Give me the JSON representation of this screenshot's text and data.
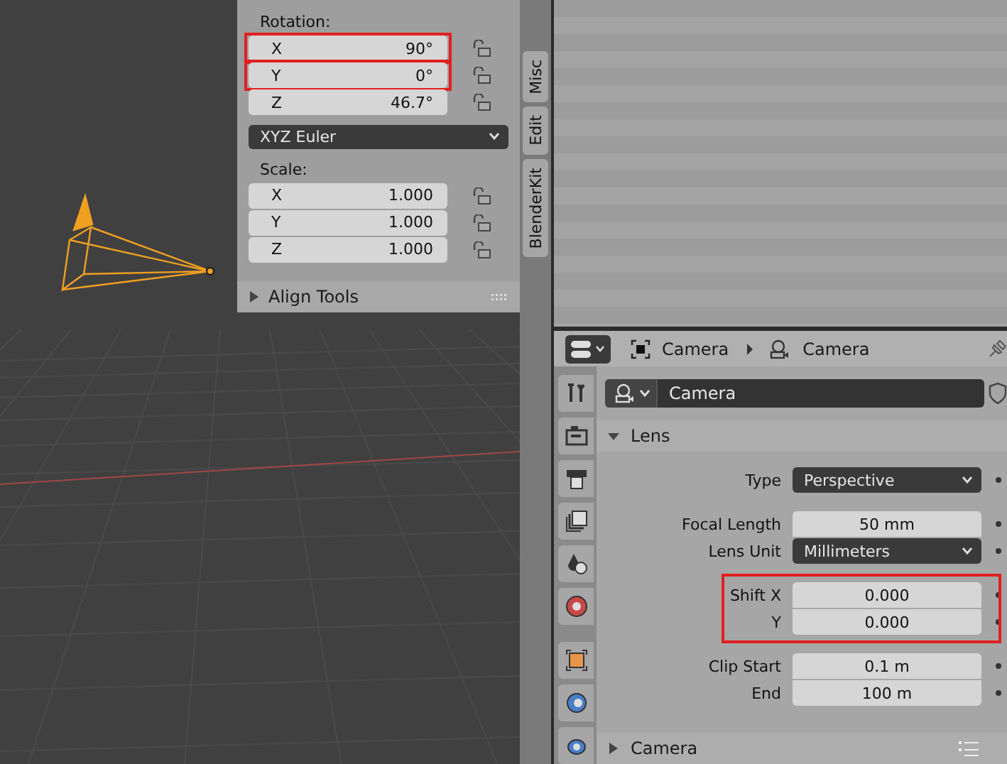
{
  "viewport": {
    "n_panel": {
      "rotation": {
        "label": "Rotation:",
        "fields": [
          {
            "axis": "X",
            "value": "90°",
            "highlighted": true
          },
          {
            "axis": "Y",
            "value": "0°",
            "highlighted": true
          },
          {
            "axis": "Z",
            "value": "46.7°",
            "highlighted": false
          }
        ]
      },
      "rotation_mode": "XYZ Euler",
      "scale": {
        "label": "Scale:",
        "fields": [
          {
            "axis": "X",
            "value": "1.000",
            "highlighted": false
          },
          {
            "axis": "Y",
            "value": "1.000",
            "highlighted": false
          },
          {
            "axis": "Z",
            "value": "1.000",
            "highlighted": false
          }
        ]
      },
      "align_tools": {
        "title": "Align Tools",
        "expanded": false
      }
    },
    "tabs": [
      "Misc",
      "Edit",
      "BlenderKit"
    ]
  },
  "properties": {
    "breadcrumb": [
      "Camera",
      "Camera"
    ],
    "datablock": "Camera",
    "panels": [
      {
        "title": "Lens",
        "expanded": true,
        "groups": [
          {
            "highlighted": false,
            "rows": [
              {
                "kind": "dropdown",
                "label": "Type",
                "value": "Perspective"
              }
            ]
          },
          {
            "highlighted": false,
            "rows": [
              {
                "kind": "number",
                "label": "Focal Length",
                "value": "50 mm"
              },
              {
                "kind": "dropdown",
                "label": "Lens Unit",
                "value": "Millimeters"
              }
            ]
          },
          {
            "highlighted": true,
            "rows": [
              {
                "kind": "number",
                "label": "Shift X",
                "value": "0.000"
              },
              {
                "kind": "number",
                "label": "Y",
                "value": "0.000"
              }
            ]
          },
          {
            "highlighted": false,
            "rows": [
              {
                "kind": "number",
                "label": "Clip Start",
                "value": "0.1 m"
              },
              {
                "kind": "number",
                "label": "End",
                "value": "100 m"
              }
            ]
          }
        ]
      },
      {
        "title": "Camera",
        "expanded": false
      }
    ]
  }
}
